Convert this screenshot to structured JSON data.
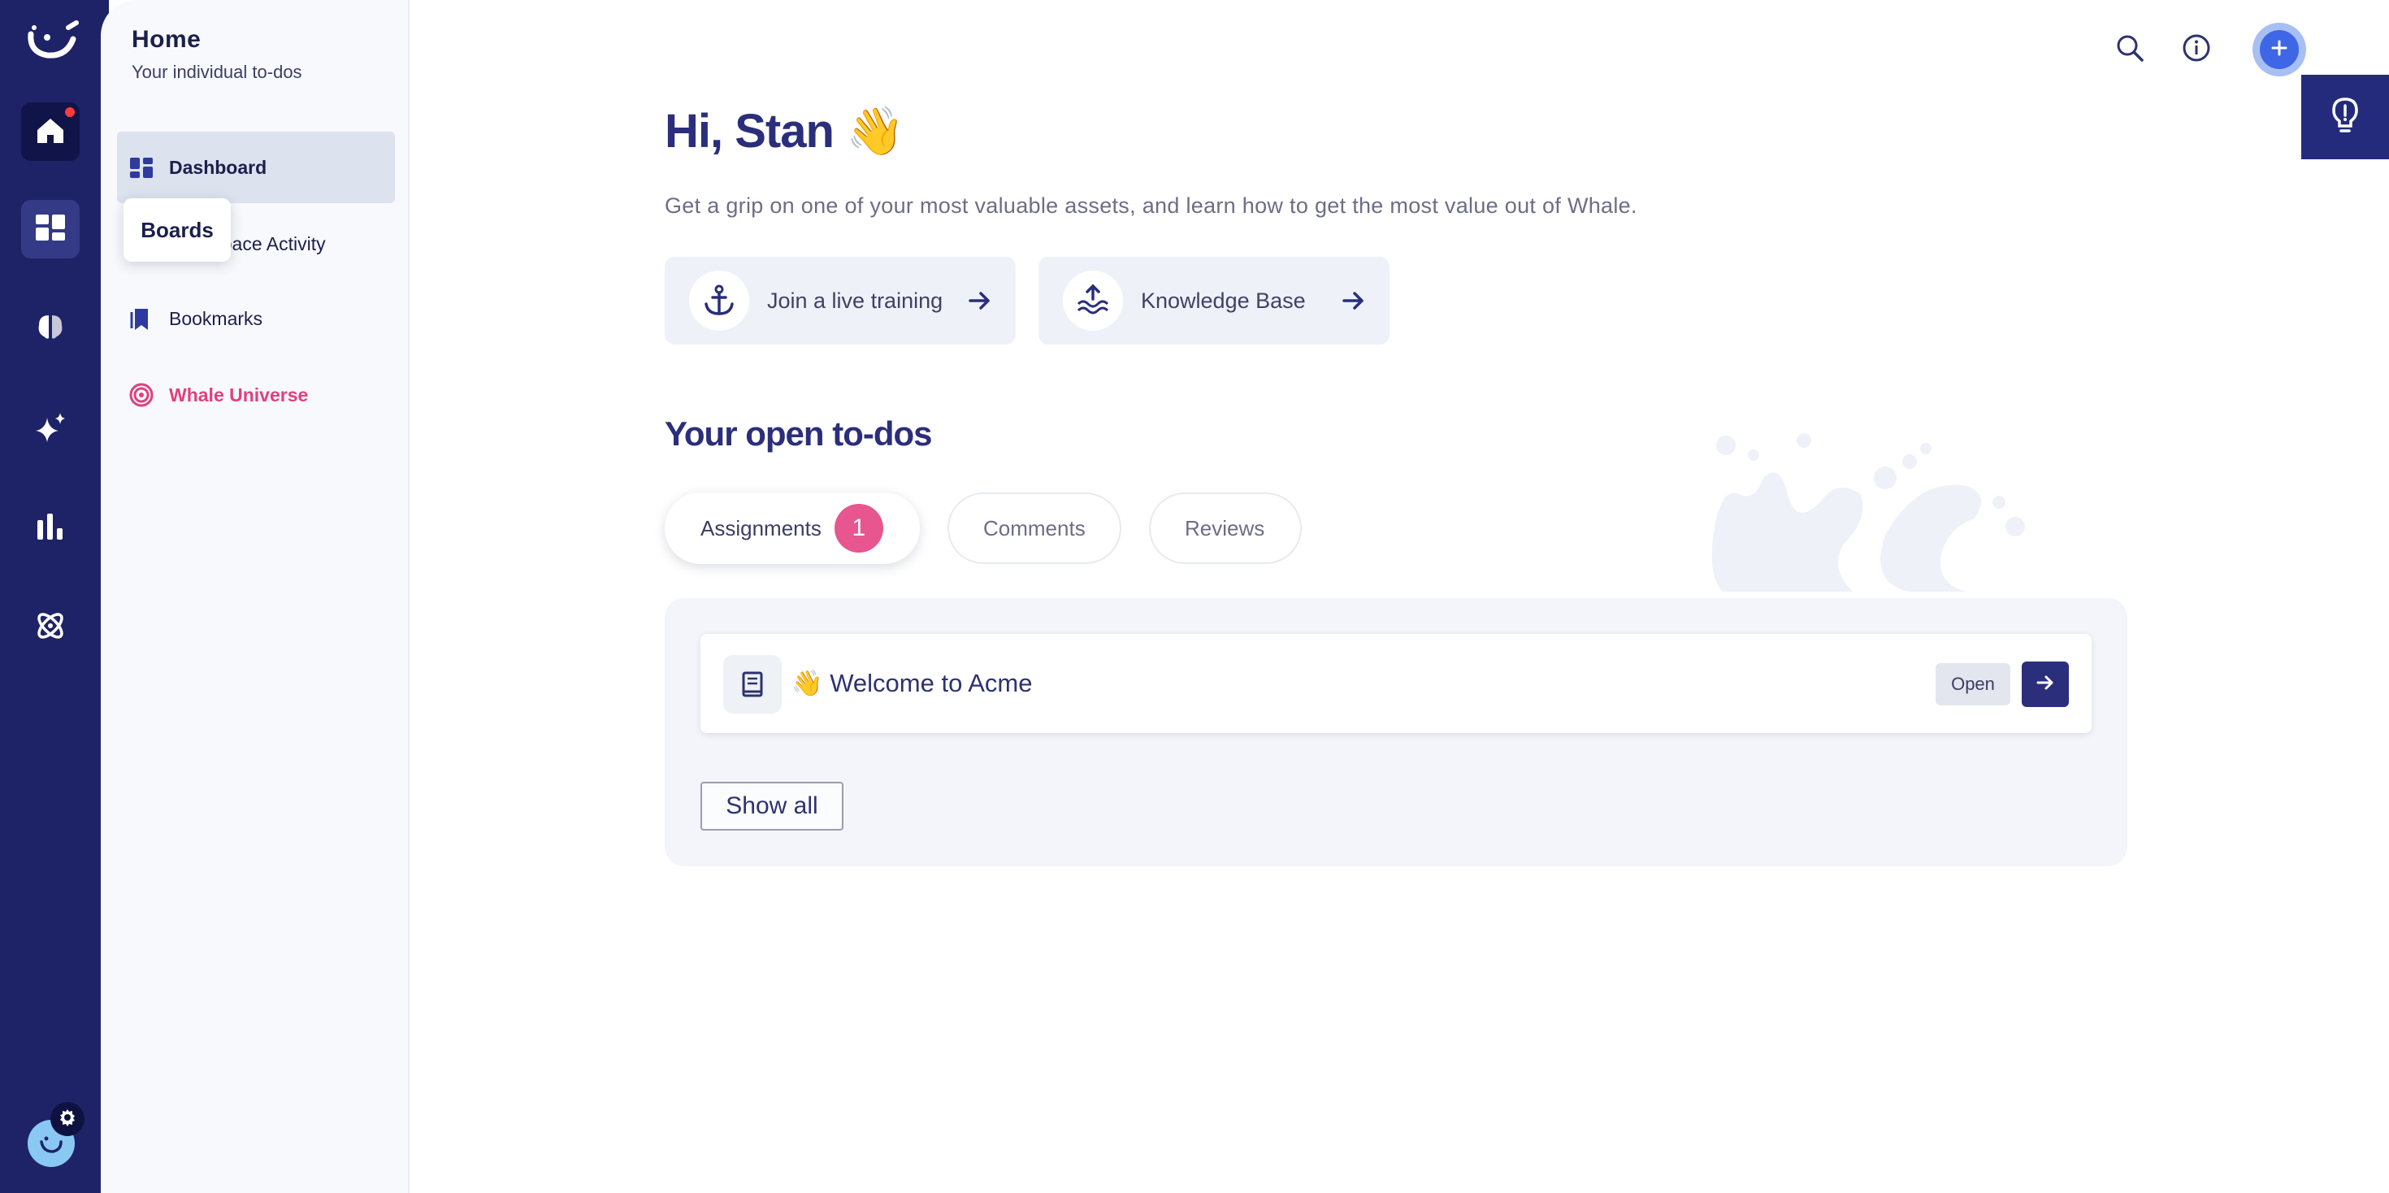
{
  "rail": {
    "icons": [
      "whale-logo-icon",
      "home-icon",
      "boards-icon",
      "brain-icon",
      "sparkle-icon",
      "analytics-icon",
      "atom-icon"
    ],
    "tooltip": "Boards"
  },
  "sidebar": {
    "title": "Home",
    "subtitle": "Your individual to-dos",
    "items": [
      {
        "label": "Dashboard",
        "icon": "dashboard-icon"
      },
      {
        "label": "Workspace Activity",
        "icon": "activity-icon"
      },
      {
        "label": "Bookmarks",
        "icon": "bookmark-icon"
      },
      {
        "label": "Whale Universe",
        "icon": "target-icon"
      }
    ]
  },
  "header": {
    "icons": [
      "search-icon",
      "info-icon",
      "plus-icon",
      "lightbulb-icon"
    ]
  },
  "main": {
    "greeting": "Hi, Stan 👋",
    "intro": "Get a grip on one of your most valuable assets, and learn how to get the most value out of Whale.",
    "links": [
      {
        "label": "Join a live training",
        "icon": "anchor-icon"
      },
      {
        "label": "Knowledge Base",
        "icon": "water-icon"
      }
    ],
    "section_title": "Your open to-dos",
    "tabs": [
      {
        "label": "Assignments",
        "count": "1"
      },
      {
        "label": "Comments"
      },
      {
        "label": "Reviews"
      }
    ],
    "todos": [
      {
        "title": "👋 Welcome to Acme",
        "open_label": "Open"
      }
    ],
    "show_all": "Show all"
  },
  "colors": {
    "rail": "#1e2367",
    "accent": "#2a2e7b",
    "pink": "#e7568f",
    "blue": "#3f66e6"
  }
}
